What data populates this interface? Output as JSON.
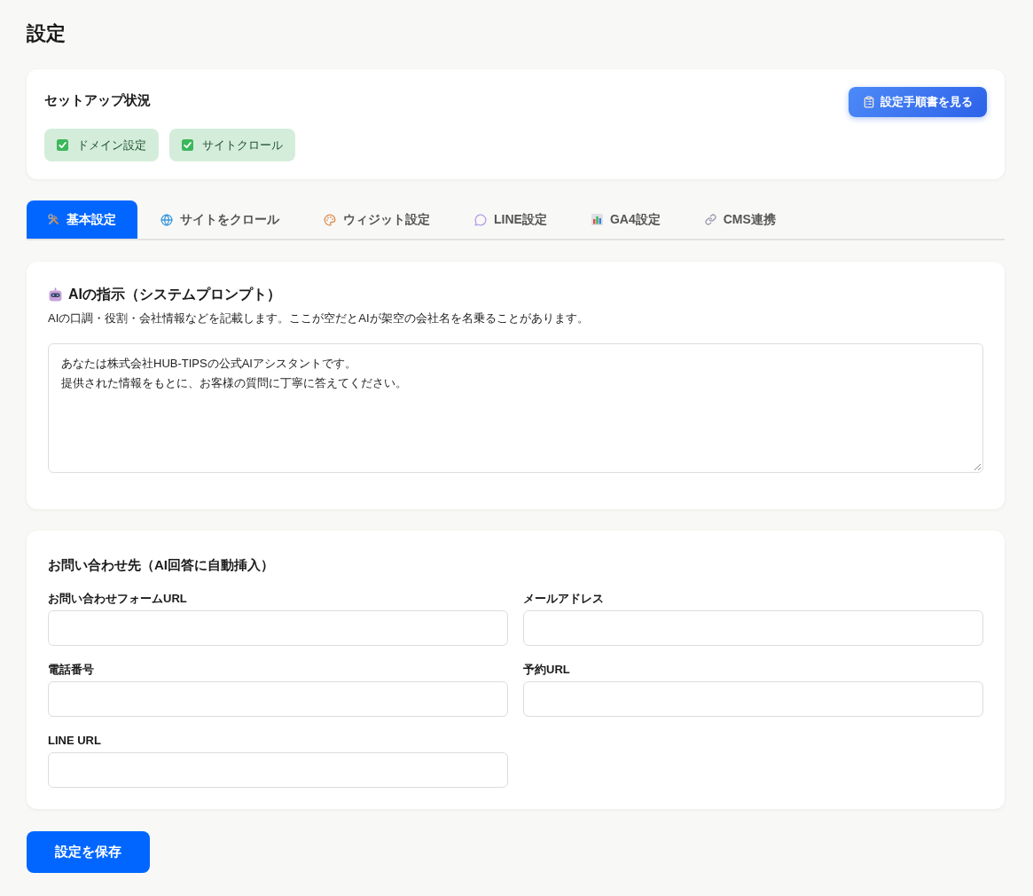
{
  "page": {
    "title": "設定"
  },
  "setup_status": {
    "title": "セットアップ状況",
    "guide_button": "設定手順書を見る",
    "items": [
      {
        "label": "ドメイン設定",
        "done": true
      },
      {
        "label": "サイトクロール",
        "done": true
      }
    ]
  },
  "tabs": [
    {
      "label": "基本設定",
      "selected": true
    },
    {
      "label": "サイトをクロール",
      "selected": false
    },
    {
      "label": "ウィジット設定",
      "selected": false
    },
    {
      "label": "LINE設定",
      "selected": false
    },
    {
      "label": "GA4設定",
      "selected": false
    },
    {
      "label": "CMS連携",
      "selected": false
    }
  ],
  "system_prompt": {
    "title": "AIの指示（システムプロンプト）",
    "description": "AIの口調・役割・会社情報などを記載します。ここが空だとAIが架空の会社名を名乗ることがあります。",
    "value_lines": [
      "あなたは株式会社HUB-TIPSの公式AIアシスタントです。",
      "提供された情報をもとに、お客様の質問に丁寧に答えてください。"
    ]
  },
  "contact": {
    "title": "お問い合わせ先（AI回答に自動挿入）",
    "fields": [
      {
        "label": "お問い合わせフォームURL"
      },
      {
        "label": "メールアドレス"
      },
      {
        "label": "電話番号"
      },
      {
        "label": "予約URL"
      },
      {
        "label": "LINE URL"
      }
    ]
  },
  "save_button": "設定を保存"
}
